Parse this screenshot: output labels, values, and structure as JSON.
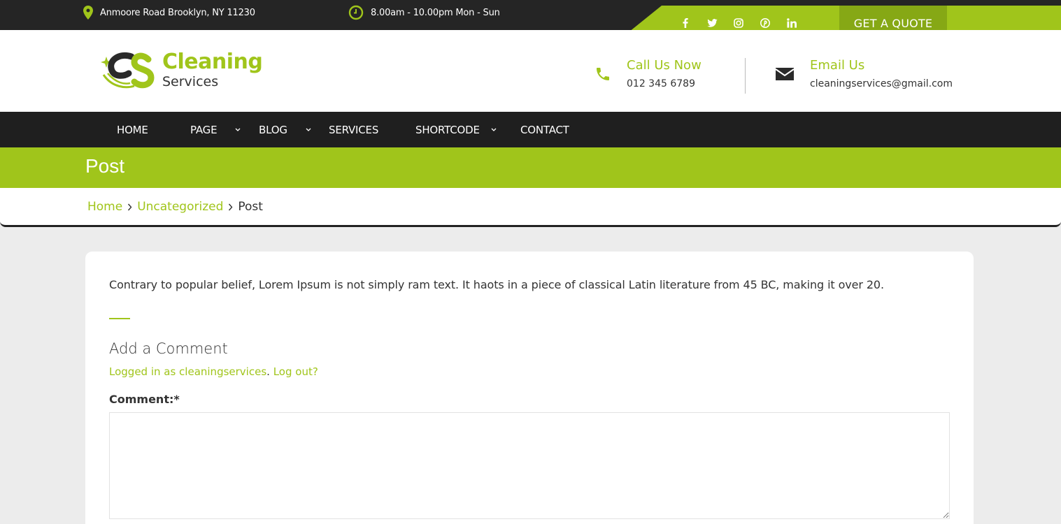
{
  "topbar": {
    "address": "Anmoore Road Brooklyn, NY 11230",
    "hours": "8.00am - 10.00pm Mon - Sun",
    "social": [
      "facebook-icon",
      "twitter-icon",
      "instagram-icon",
      "pinterest-icon",
      "linkedin-icon"
    ],
    "quote_label": "GET A QUOTE"
  },
  "header": {
    "logo_title": "Cleaning",
    "logo_subtitle": "Services",
    "call_label": "Call Us Now",
    "call_value": "012 345 6789",
    "email_label": "Email Us",
    "email_value": "cleaningservices@gmail.com"
  },
  "nav": {
    "items": [
      {
        "label": "HOME",
        "has_dropdown": false
      },
      {
        "label": "PAGE",
        "has_dropdown": true
      },
      {
        "label": "BLOG",
        "has_dropdown": true
      },
      {
        "label": "SERVICES",
        "has_dropdown": false
      },
      {
        "label": "SHORTCODE",
        "has_dropdown": true
      },
      {
        "label": "CONTACT",
        "has_dropdown": false
      }
    ]
  },
  "page": {
    "title": "Post",
    "breadcrumb": [
      "Home",
      "Uncategorized",
      "Post"
    ]
  },
  "content": {
    "post_text": "Contrary to popular belief, Lorem Ipsum is not simply ram text. It haots in a piece of classical Latin literature from 45 BC, making it over 20.",
    "comment_title": "Add a Comment",
    "logged_in_link": "Logged in as cleaningservices",
    "logged_sep": ".",
    "logout_link": "Log out?",
    "comment_label": "Comment:*",
    "comment_value": ""
  },
  "colors": {
    "accent": "#a0c51b",
    "accent_dark": "#86a815",
    "dark": "#252525",
    "nav": "#1f1f1f",
    "background": "#ececec"
  }
}
